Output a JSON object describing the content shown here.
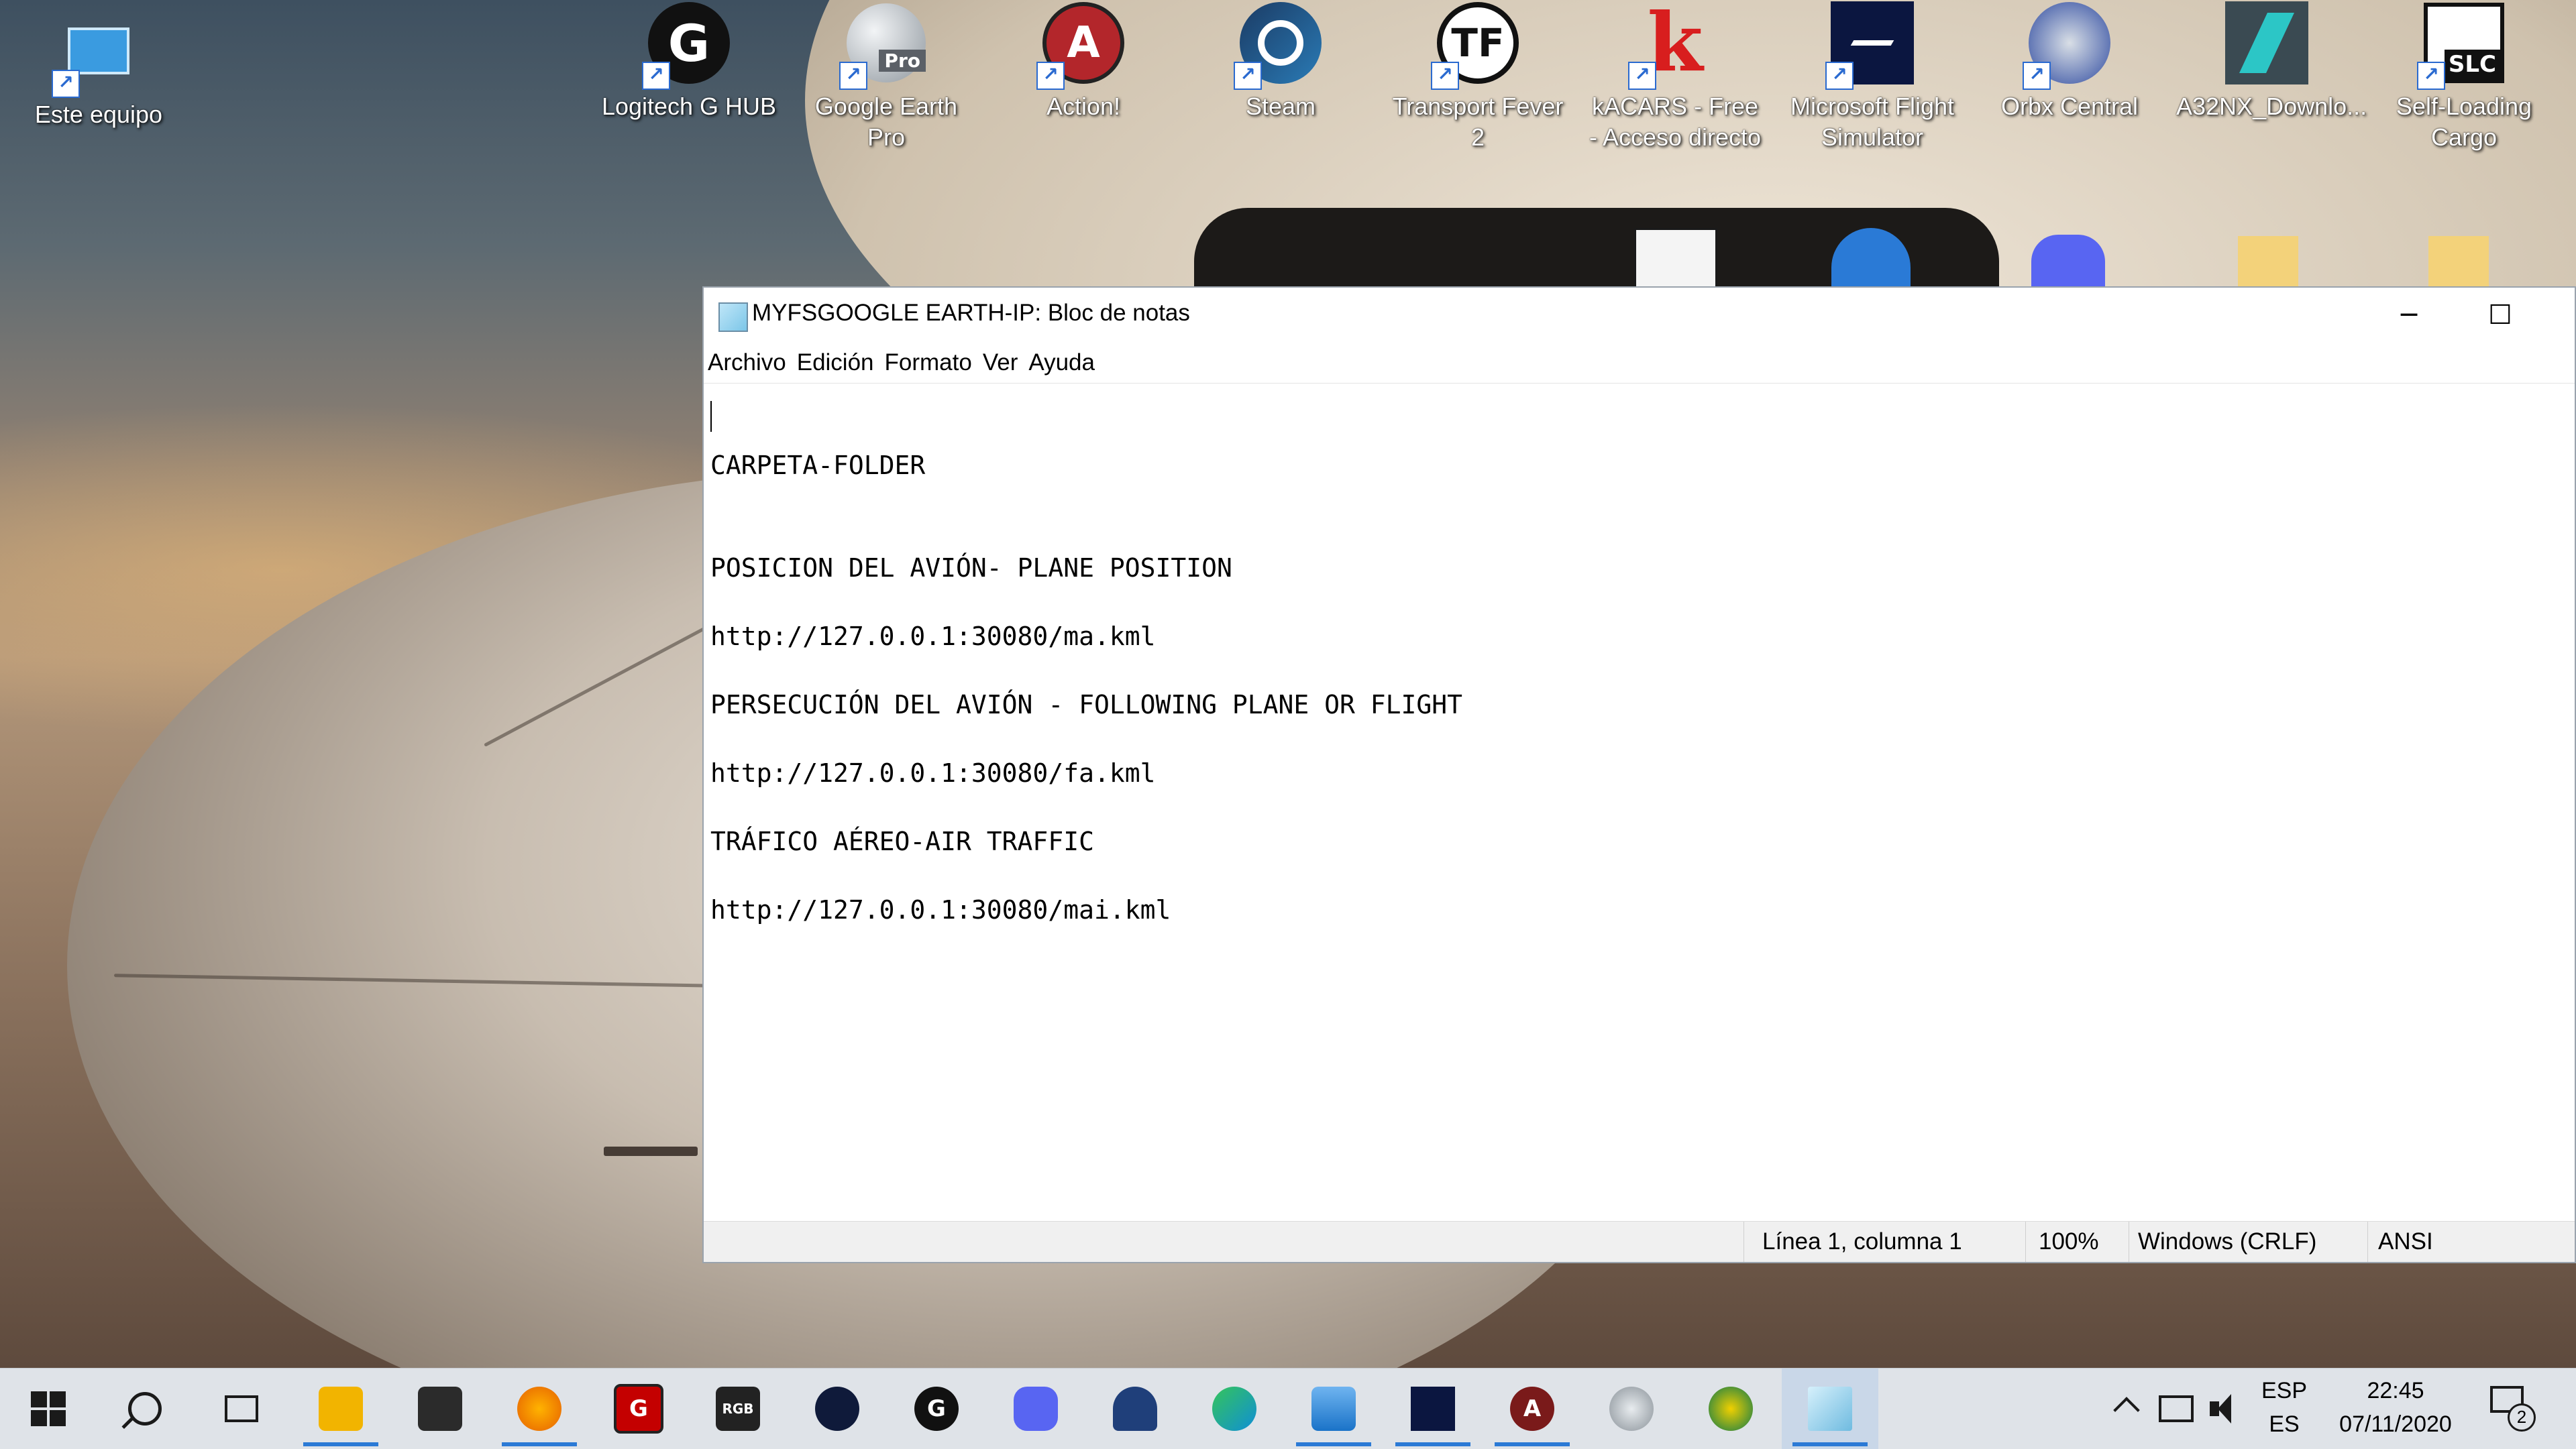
{
  "desktop": {
    "icons": [
      {
        "label": "Este equipo",
        "icon": "computer-icon",
        "color": "#3a9be0"
      },
      {
        "label": "Logitech G HUB",
        "icon": "logitech-g-icon",
        "color": "#111111"
      },
      {
        "label": "Google Earth Pro",
        "icon": "google-earth-icon",
        "color": "#9aa3aa"
      },
      {
        "label": "Action!",
        "icon": "action-recorder-icon",
        "color": "#b3262b"
      },
      {
        "label": "Steam",
        "icon": "steam-icon",
        "color": "#1b3b64"
      },
      {
        "label": "Transport Fever 2",
        "icon": "transport-fever-icon",
        "color": "#111111"
      },
      {
        "label": "kACARS - Free - Acceso directo",
        "icon": "kacars-icon",
        "color": "#d81e1e"
      },
      {
        "label": "Microsoft Flight Simulator",
        "icon": "flight-simulator-icon",
        "color": "#0b1640"
      },
      {
        "label": "Orbx Central",
        "icon": "orbx-icon",
        "color": "#2e4aa0"
      },
      {
        "label": "A32NX_Downlo...",
        "icon": "a32nx-icon",
        "color": "#3a4a52"
      },
      {
        "label": "Self-Loading Cargo",
        "icon": "slc-icon",
        "color": "#111111"
      }
    ]
  },
  "notepad": {
    "title": "MYFSGOOGLE EARTH-IP: Bloc de notas",
    "controls": {
      "minimize": "─",
      "maximize": "☐",
      "close": "✕"
    },
    "menu": [
      "Archivo",
      "Edición",
      "Formato",
      "Ver",
      "Ayuda"
    ],
    "lines": [
      "CARPETA-FOLDER",
      "POSICION DEL AVIÓN- PLANE POSITION",
      "http://127.0.0.1:30080/ma.kml",
      "PERSECUCIÓN DEL AVIÓN - FOLLOWING PLANE OR FLIGHT",
      "http://127.0.0.1:30080/fa.kml",
      "TRÁFICO AÉREO-AIR TRAFFIC",
      "http://127.0.0.1:30080/mai.kml"
    ],
    "status": {
      "position": "Línea 1, columna 1",
      "zoom": "100%",
      "line_ending": "Windows (CRLF)",
      "encoding": "ANSI"
    }
  },
  "taskbar": {
    "apps": [
      {
        "icon": "start-icon",
        "color": "#1a1a1a"
      },
      {
        "icon": "search-icon",
        "color": "#1a1a1a"
      },
      {
        "icon": "task-view-icon",
        "color": "#1a1a1a"
      },
      {
        "icon": "file-explorer-icon",
        "color": "#f2b400"
      },
      {
        "icon": "store-icon",
        "color": "#2b2b2b"
      },
      {
        "icon": "firefox-icon",
        "color": "#e66000"
      },
      {
        "icon": "gaming-app-icon",
        "color": "#c40000"
      },
      {
        "icon": "rgb-fusion-icon",
        "color": "#222222"
      },
      {
        "icon": "keypad-app-icon",
        "color": "#0f1a3a"
      },
      {
        "icon": "logitech-g-icon",
        "color": "#111111"
      },
      {
        "icon": "discord-icon",
        "color": "#5865f2"
      },
      {
        "icon": "cloud-app-icon",
        "color": "#1f3f7a"
      },
      {
        "icon": "edge-icon",
        "color": "#0f8fd6"
      },
      {
        "icon": "photos-icon",
        "color": "#1a73c8"
      },
      {
        "icon": "flight-simulator-icon",
        "color": "#0b1640"
      },
      {
        "icon": "action-recorder-icon",
        "color": "#7a1a1a"
      },
      {
        "icon": "google-earth-icon",
        "color": "#8a9299"
      },
      {
        "icon": "plane-tracker-icon",
        "color": "#0d7a4a"
      },
      {
        "icon": "notepad-icon",
        "color": "#6fbbe0"
      }
    ],
    "tray": {
      "language_top": "ESP",
      "language_bottom": "ES",
      "time": "22:45",
      "date": "07/11/2020",
      "notifications_count": "2"
    }
  }
}
